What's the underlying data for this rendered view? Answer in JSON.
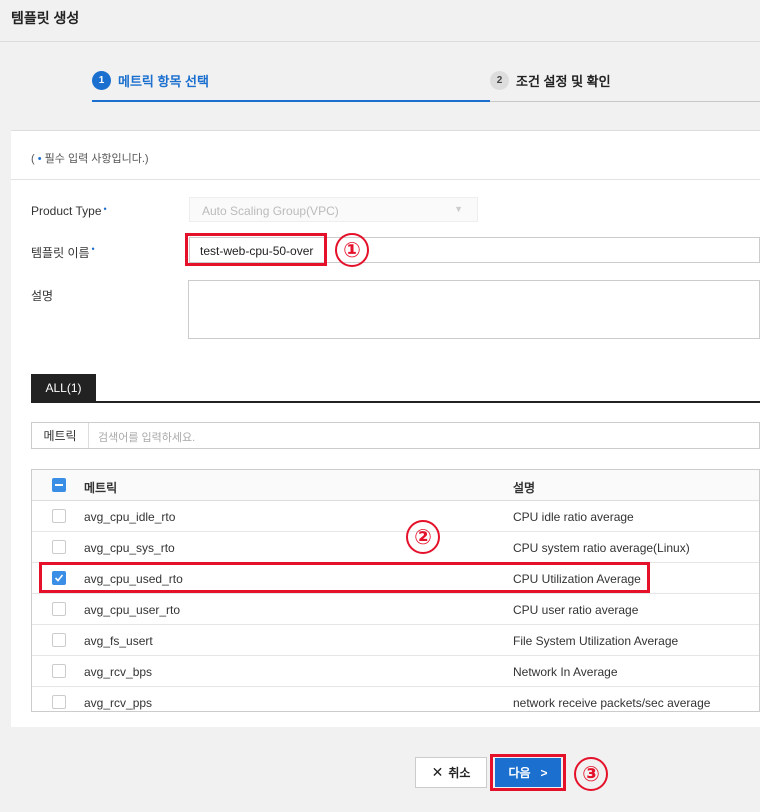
{
  "page": {
    "title": "템플릿 생성"
  },
  "steps": [
    {
      "num": "1",
      "label": "메트릭 항목 선택",
      "active": true
    },
    {
      "num": "2",
      "label": "조건 설정 및 확인",
      "active": false
    }
  ],
  "form": {
    "required_note_prefix": "( ",
    "required_note_dot": "•",
    "required_note_text": " 필수 입력 사항입니다.)",
    "product_type_label": "Product Type",
    "product_type_value": "Auto Scaling Group(VPC)",
    "template_name_label": "템플릿 이름",
    "template_name_value": "test-web-cpu-50-over",
    "description_label": "설명",
    "required_mark": "•"
  },
  "tabs": [
    {
      "label": "ALL(1)"
    }
  ],
  "search": {
    "label": "메트릭",
    "placeholder": "검색어를 입력하세요."
  },
  "table": {
    "headers": {
      "metric": "메트릭",
      "description": "설명"
    },
    "rows": [
      {
        "metric": "avg_cpu_idle_rto",
        "description": "CPU idle ratio average",
        "checked": false
      },
      {
        "metric": "avg_cpu_sys_rto",
        "description": "CPU system ratio average(Linux)",
        "checked": false
      },
      {
        "metric": "avg_cpu_used_rto",
        "description": "CPU Utilization Average",
        "checked": true
      },
      {
        "metric": "avg_cpu_user_rto",
        "description": "CPU user ratio average",
        "checked": false
      },
      {
        "metric": "avg_fs_usert",
        "description": "File System Utilization Average",
        "checked": false
      },
      {
        "metric": "avg_rcv_bps",
        "description": "Network In Average",
        "checked": false
      },
      {
        "metric": "avg_rcv_pps",
        "description": "network receive packets/sec average",
        "checked": false
      }
    ]
  },
  "buttons": {
    "cancel": "취소",
    "next": "다음"
  },
  "annotations": {
    "badge1": "①",
    "badge2": "②",
    "badge3": "③"
  },
  "colors": {
    "accent": "#1a6fcf",
    "callout": "#e5112a",
    "checkbox": "#3a8ee6"
  }
}
